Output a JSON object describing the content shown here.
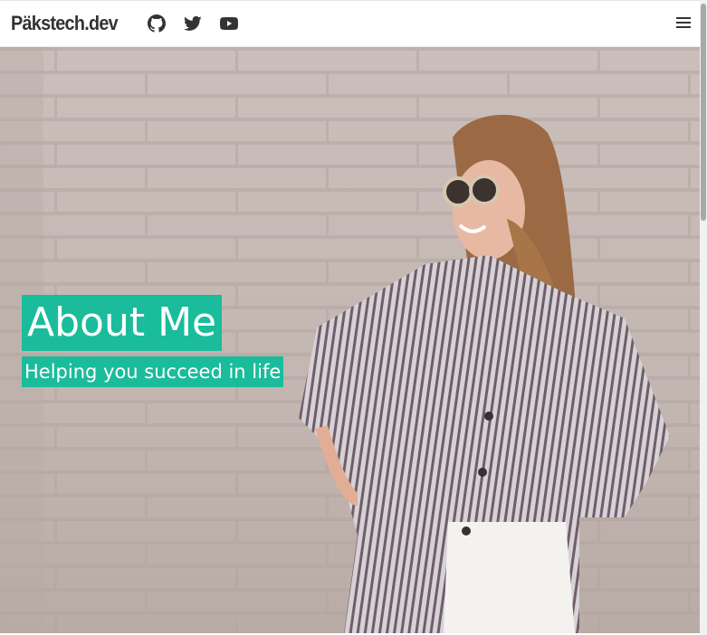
{
  "navbar": {
    "brand": "Päkstech.dev",
    "social": [
      {
        "name": "github-icon"
      },
      {
        "name": "twitter-icon"
      },
      {
        "name": "youtube-icon"
      }
    ],
    "menu_icon": "hamburger-icon"
  },
  "hero": {
    "title": "About Me",
    "subtitle": "Helping you succeed in life",
    "accent_color": "#1abc9c"
  }
}
